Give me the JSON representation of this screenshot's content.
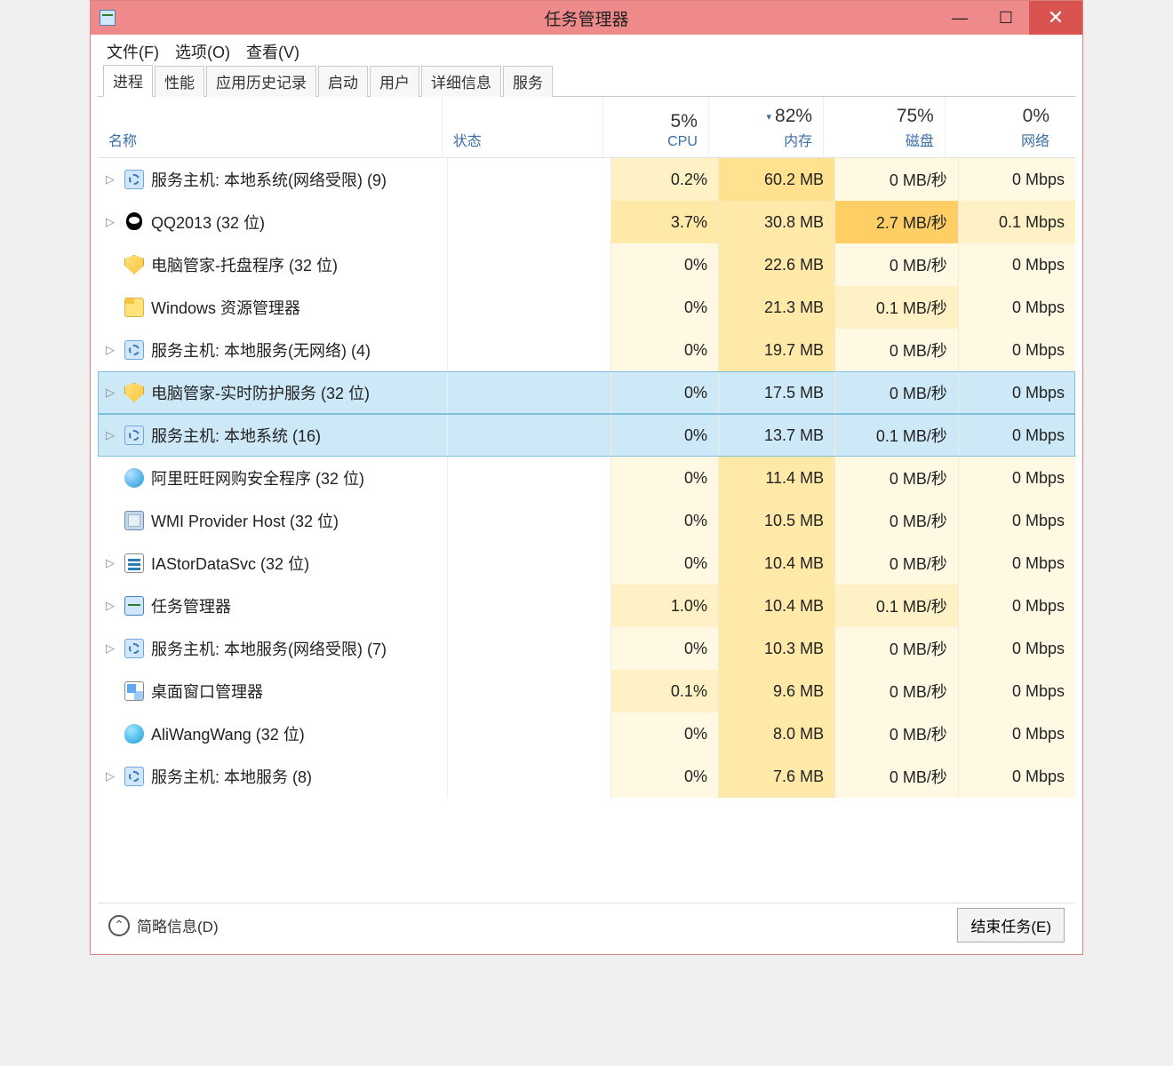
{
  "window": {
    "title": "任务管理器"
  },
  "menu": {
    "file": "文件(F)",
    "options": "选项(O)",
    "view": "查看(V)"
  },
  "tabs": [
    {
      "label": "进程",
      "active": true
    },
    {
      "label": "性能"
    },
    {
      "label": "应用历史记录"
    },
    {
      "label": "启动"
    },
    {
      "label": "用户"
    },
    {
      "label": "详细信息"
    },
    {
      "label": "服务"
    }
  ],
  "columns": {
    "name": "名称",
    "status": "状态",
    "cpu": {
      "pct": "5%",
      "label": "CPU"
    },
    "mem": {
      "pct": "82%",
      "label": "内存",
      "sorted": true
    },
    "disk": {
      "pct": "75%",
      "label": "磁盘"
    },
    "net": {
      "pct": "0%",
      "label": "网络"
    }
  },
  "rows": [
    {
      "exp": true,
      "icon": "ic-gear",
      "name": "服务主机: 本地系统(网络受限) (9)",
      "cpu": "0.2%",
      "cpuH": "h-cpu1",
      "mem": "60.2 MB",
      "memH": "h-mem2",
      "disk": "0 MB/秒",
      "diskH": "h-disk0",
      "net": "0 Mbps",
      "netH": "h-net0"
    },
    {
      "exp": true,
      "icon": "ic-qq",
      "name": "QQ2013 (32 位)",
      "cpu": "3.7%",
      "cpuH": "h-cpu2",
      "mem": "30.8 MB",
      "memH": "h-mem1",
      "disk": "2.7 MB/秒",
      "diskH": "h-disk2",
      "net": "0.1 Mbps",
      "netH": "h-net1"
    },
    {
      "exp": false,
      "icon": "ic-shield",
      "name": "电脑管家-托盘程序 (32 位)",
      "cpu": "0%",
      "cpuH": "h-cpu0",
      "mem": "22.6 MB",
      "memH": "h-mem1",
      "disk": "0 MB/秒",
      "diskH": "h-disk0",
      "net": "0 Mbps",
      "netH": "h-net0"
    },
    {
      "exp": false,
      "icon": "ic-explorer",
      "name": "Windows 资源管理器",
      "cpu": "0%",
      "cpuH": "h-cpu0",
      "mem": "21.3 MB",
      "memH": "h-mem1",
      "disk": "0.1 MB/秒",
      "diskH": "h-disk1",
      "net": "0 Mbps",
      "netH": "h-net0"
    },
    {
      "exp": true,
      "icon": "ic-gear",
      "name": "服务主机: 本地服务(无网络) (4)",
      "cpu": "0%",
      "cpuH": "h-cpu0",
      "mem": "19.7 MB",
      "memH": "h-mem1",
      "disk": "0 MB/秒",
      "diskH": "h-disk0",
      "net": "0 Mbps",
      "netH": "h-net0"
    },
    {
      "exp": true,
      "icon": "ic-shield",
      "name": "电脑管家-实时防护服务 (32 位)",
      "cpu": "0%",
      "cpuH": "h-cpu0",
      "mem": "17.5 MB",
      "memH": "h-mem1",
      "disk": "0 MB/秒",
      "diskH": "h-disk0",
      "net": "0 Mbps",
      "netH": "h-net0",
      "selected": true
    },
    {
      "exp": true,
      "icon": "ic-gear",
      "name": "服务主机: 本地系统 (16)",
      "cpu": "0%",
      "cpuH": "h-cpu0",
      "mem": "13.7 MB",
      "memH": "h-mem1",
      "disk": "0.1 MB/秒",
      "diskH": "h-disk1",
      "net": "0 Mbps",
      "netH": "h-net0",
      "selected": true
    },
    {
      "exp": false,
      "icon": "ic-ball",
      "name": "阿里旺旺网购安全程序 (32 位)",
      "cpu": "0%",
      "cpuH": "h-cpu0",
      "mem": "11.4 MB",
      "memH": "h-mem1",
      "disk": "0 MB/秒",
      "diskH": "h-disk0",
      "net": "0 Mbps",
      "netH": "h-net0"
    },
    {
      "exp": false,
      "icon": "ic-wmi",
      "name": "WMI Provider Host (32 位)",
      "cpu": "0%",
      "cpuH": "h-cpu0",
      "mem": "10.5 MB",
      "memH": "h-mem1",
      "disk": "0 MB/秒",
      "diskH": "h-disk0",
      "net": "0 Mbps",
      "netH": "h-net0"
    },
    {
      "exp": true,
      "icon": "ic-iastor",
      "name": "IAStorDataSvc (32 位)",
      "cpu": "0%",
      "cpuH": "h-cpu0",
      "mem": "10.4 MB",
      "memH": "h-mem1",
      "disk": "0 MB/秒",
      "diskH": "h-disk0",
      "net": "0 Mbps",
      "netH": "h-net0"
    },
    {
      "exp": true,
      "icon": "ic-tm",
      "name": "任务管理器",
      "cpu": "1.0%",
      "cpuH": "h-cpu1",
      "mem": "10.4 MB",
      "memH": "h-mem1",
      "disk": "0.1 MB/秒",
      "diskH": "h-disk1",
      "net": "0 Mbps",
      "netH": "h-net0"
    },
    {
      "exp": true,
      "icon": "ic-gear",
      "name": "服务主机: 本地服务(网络受限) (7)",
      "cpu": "0%",
      "cpuH": "h-cpu0",
      "mem": "10.3 MB",
      "memH": "h-mem1",
      "disk": "0 MB/秒",
      "diskH": "h-disk0",
      "net": "0 Mbps",
      "netH": "h-net0"
    },
    {
      "exp": false,
      "icon": "ic-dwm",
      "name": "桌面窗口管理器",
      "cpu": "0.1%",
      "cpuH": "h-cpu1",
      "mem": "9.6 MB",
      "memH": "h-mem1",
      "disk": "0 MB/秒",
      "diskH": "h-disk0",
      "net": "0 Mbps",
      "netH": "h-net0"
    },
    {
      "exp": false,
      "icon": "ic-ali",
      "name": "AliWangWang (32 位)",
      "cpu": "0%",
      "cpuH": "h-cpu0",
      "mem": "8.0 MB",
      "memH": "h-mem1",
      "disk": "0 MB/秒",
      "diskH": "h-disk0",
      "net": "0 Mbps",
      "netH": "h-net0"
    },
    {
      "exp": true,
      "icon": "ic-gear",
      "name": "服务主机: 本地服务 (8)",
      "cpu": "0%",
      "cpuH": "h-cpu0",
      "mem": "7.6 MB",
      "memH": "h-mem1",
      "disk": "0 MB/秒",
      "diskH": "h-disk0",
      "net": "0 Mbps",
      "netH": "h-net0"
    }
  ],
  "footer": {
    "fewer": "简略信息(D)",
    "endtask": "结束任务(E)"
  }
}
